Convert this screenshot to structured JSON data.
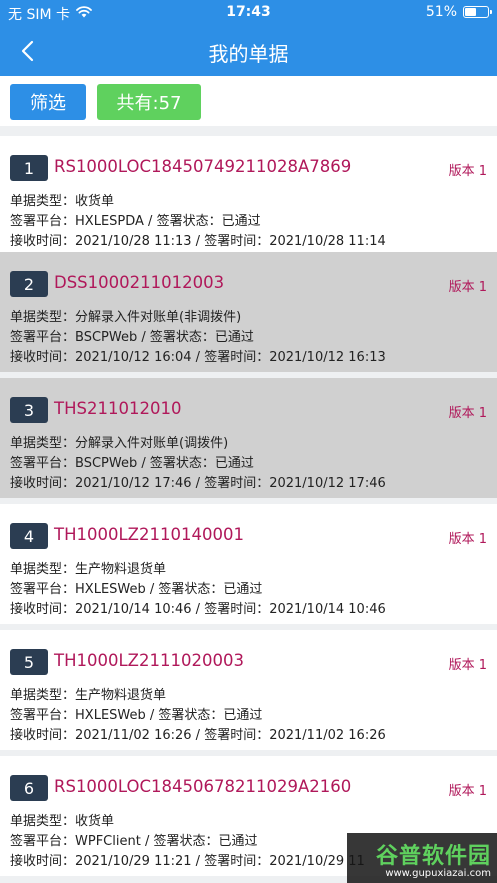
{
  "status": {
    "carrier": "无 SIM 卡",
    "time": "17:43",
    "battery_text": "51%",
    "battery_level": 0.51
  },
  "nav": {
    "title": "我的单据"
  },
  "toolbar": {
    "filter_label": "筛选",
    "total_label": "共有:57"
  },
  "items": [
    {
      "index": "1",
      "code": "RS1000LOC18450749211028A7869",
      "version": "版本 1",
      "type_label": "单据类型：",
      "type": "收货单",
      "platform_label": "签署平台：",
      "platform": "HXLESPDA",
      "sep": " / ",
      "status_label": "签署状态：",
      "status": "已通过",
      "recv_label": "接收时间：",
      "recv": "2021/10/28 11:13",
      "sign_label": "签署时间：",
      "sign": "2021/10/28 11:14",
      "highlight": false
    },
    {
      "index": "2",
      "code": "DSS1000211012003",
      "version": "版本 1",
      "type_label": "单据类型：",
      "type": "分解录入件对账单(非调拨件)",
      "platform_label": "签署平台：",
      "platform": "BSCPWeb",
      "sep": " / ",
      "status_label": "签署状态：",
      "status": "已通过",
      "recv_label": "接收时间：",
      "recv": "2021/10/12 16:04",
      "sign_label": "签署时间：",
      "sign": "2021/10/12 16:13",
      "highlight": true
    },
    {
      "index": "3",
      "code": "THS211012010",
      "version": "版本 1",
      "type_label": "单据类型：",
      "type": "分解录入件对账单(调拨件)",
      "platform_label": "签署平台：",
      "platform": "BSCPWeb",
      "sep": " / ",
      "status_label": "签署状态：",
      "status": "已通过",
      "recv_label": "接收时间：",
      "recv": "2021/10/12 17:46",
      "sign_label": "签署时间：",
      "sign": "2021/10/12 17:46",
      "highlight": true
    },
    {
      "index": "4",
      "code": "TH1000LZ2110140001",
      "version": "版本 1",
      "type_label": "单据类型：",
      "type": "生产物料退货单",
      "platform_label": "签署平台：",
      "platform": "HXLESWeb",
      "sep": " / ",
      "status_label": "签署状态：",
      "status": "已通过",
      "recv_label": "接收时间：",
      "recv": "2021/10/14 10:46",
      "sign_label": "签署时间：",
      "sign": "2021/10/14 10:46",
      "highlight": false
    },
    {
      "index": "5",
      "code": "TH1000LZ2111020003",
      "version": "版本 1",
      "type_label": "单据类型：",
      "type": "生产物料退货单",
      "platform_label": "签署平台：",
      "platform": "HXLESWeb",
      "sep": " / ",
      "status_label": "签署状态：",
      "status": "已通过",
      "recv_label": "接收时间：",
      "recv": "2021/11/02 16:26",
      "sign_label": "签署时间：",
      "sign": "2021/11/02 16:26",
      "highlight": false
    },
    {
      "index": "6",
      "code": "RS1000LOC18450678211029A2160",
      "version": "版本 1",
      "type_label": "单据类型：",
      "type": "收货单",
      "platform_label": "签署平台：",
      "platform": "WPFClient",
      "sep": " / ",
      "status_label": "签署状态：",
      "status": "已通过",
      "recv_label": "接收时间：",
      "recv": "2021/10/29 11:21",
      "sign_label": "签署时间：",
      "sign": "2021/10/29 11",
      "highlight": false
    }
  ],
  "watermark": {
    "main": "谷普软件园",
    "url": "www.gupuxiazai.com"
  },
  "colors": {
    "primary": "#2d8fe6",
    "success": "#5fd15e",
    "code": "#b0185a",
    "badge": "#2b3d52",
    "highlight_row": "#d0d0d0"
  }
}
